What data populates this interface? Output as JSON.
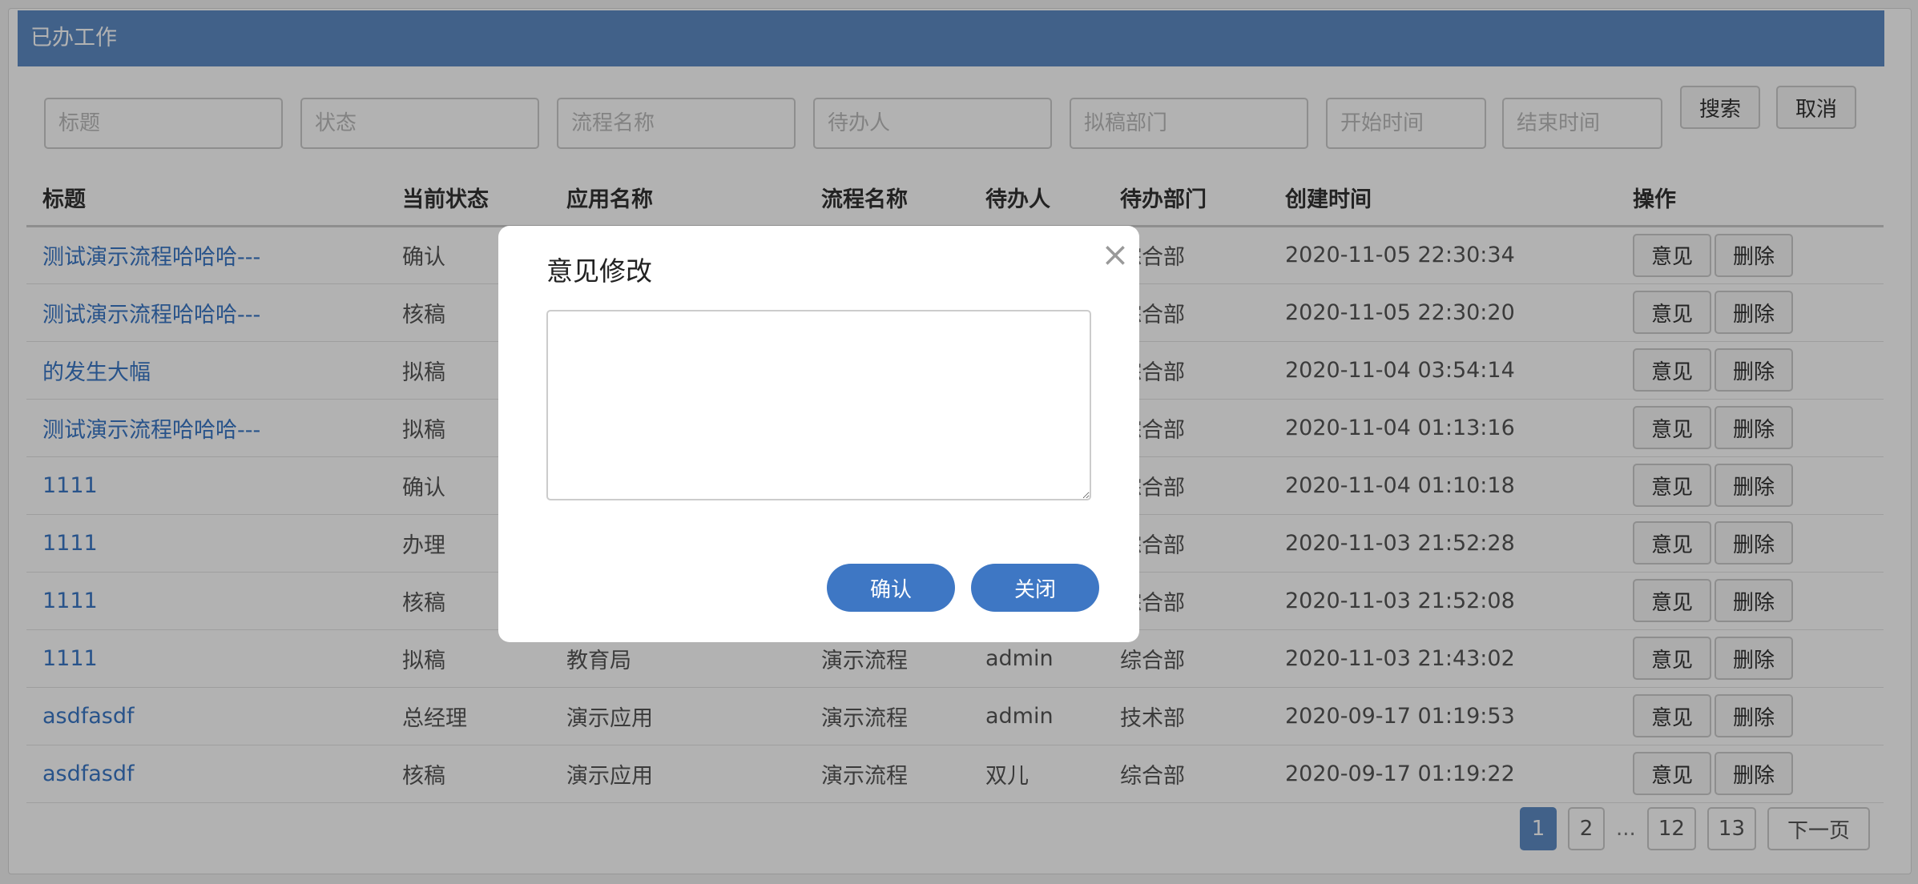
{
  "header": {
    "title": "已办工作"
  },
  "filters": {
    "title_placeholder": "标题",
    "status_placeholder": "状态",
    "flow_placeholder": "流程名称",
    "assignee_placeholder": "待办人",
    "dept_placeholder": "拟稿部门",
    "start_placeholder": "开始时间",
    "end_placeholder": "结束时间",
    "search_label": "搜索",
    "cancel_label": "取消"
  },
  "table": {
    "columns": [
      "标题",
      "当前状态",
      "应用名称",
      "流程名称",
      "待办人",
      "待办部门",
      "创建时间",
      "操作"
    ],
    "rows": [
      {
        "title": "测试演示流程哈哈哈---",
        "status": "确认",
        "app": "",
        "flow": "",
        "assignee": "",
        "dept": "综合部",
        "created": "2020-11-05 22:30:34"
      },
      {
        "title": "测试演示流程哈哈哈---",
        "status": "核稿",
        "app": "",
        "flow": "",
        "assignee": "",
        "dept": "综合部",
        "created": "2020-11-05 22:30:20"
      },
      {
        "title": "的发生大幅",
        "status": "拟稿",
        "app": "",
        "flow": "",
        "assignee": "",
        "dept": "综合部",
        "created": "2020-11-04 03:54:14"
      },
      {
        "title": "测试演示流程哈哈哈---",
        "status": "拟稿",
        "app": "",
        "flow": "",
        "assignee": "",
        "dept": "综合部",
        "created": "2020-11-04 01:13:16"
      },
      {
        "title": "1111",
        "status": "确认",
        "app": "",
        "flow": "",
        "assignee": "",
        "dept": "综合部",
        "created": "2020-11-04 01:10:18"
      },
      {
        "title": "1111",
        "status": "办理",
        "app": "",
        "flow": "",
        "assignee": "",
        "dept": "综合部",
        "created": "2020-11-03 21:52:28"
      },
      {
        "title": "1111",
        "status": "核稿",
        "app": "",
        "flow": "",
        "assignee": "",
        "dept": "综合部",
        "created": "2020-11-03 21:52:08"
      },
      {
        "title": "1111",
        "status": "拟稿",
        "app": "教育局",
        "flow": "演示流程",
        "assignee": "admin",
        "dept": "综合部",
        "created": "2020-11-03 21:43:02"
      },
      {
        "title": "asdfasdf",
        "status": "总经理",
        "app": "演示应用",
        "flow": "演示流程",
        "assignee": "admin",
        "dept": "技术部",
        "created": "2020-09-17 01:19:53"
      },
      {
        "title": "asdfasdf",
        "status": "核稿",
        "app": "演示应用",
        "flow": "演示流程",
        "assignee": "双儿",
        "dept": "综合部",
        "created": "2020-09-17 01:19:22"
      }
    ],
    "action_opinion": "意见",
    "action_delete": "删除"
  },
  "pagination": {
    "pages": [
      "1",
      "2",
      "12",
      "13"
    ],
    "active": "1",
    "ellipsis": "...",
    "next_label": "下一页"
  },
  "modal": {
    "title": "意见修改",
    "textarea_value": "",
    "confirm_label": "确认",
    "close_label": "关闭",
    "close_icon": "×"
  },
  "colors": {
    "header_bg": "#5d8cc4",
    "link": "#3a77c6",
    "primary_button": "#3e77c4"
  }
}
